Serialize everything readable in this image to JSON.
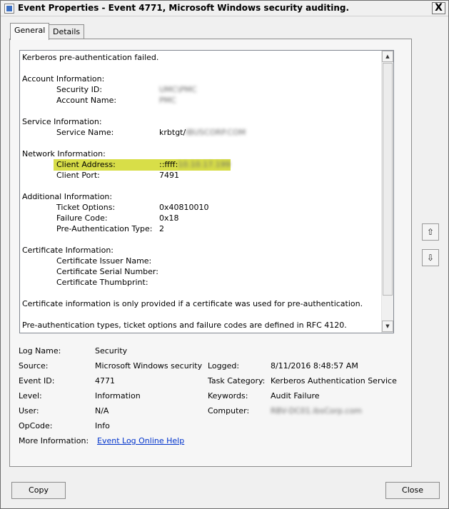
{
  "window": {
    "title": "Event Properties - Event 4771, Microsoft Windows security auditing.",
    "close_glyph": "X"
  },
  "tabs": [
    {
      "label": "General"
    },
    {
      "label": "Details"
    }
  ],
  "description": {
    "summary": "Kerberos pre-authentication failed.",
    "account_info": {
      "header": "Account Information:",
      "security_id_label": "Security ID:",
      "security_id_value": "UMC\\PMC",
      "account_name_label": "Account Name:",
      "account_name_value": "PMC"
    },
    "service_info": {
      "header": "Service Information:",
      "service_name_label": "Service Name:",
      "service_name_prefix": "krbtgt/",
      "service_name_blurred": "IBUSCORP.COM"
    },
    "network_info": {
      "header": "Network Information:",
      "client_address_label": "Client Address:",
      "client_address_prefix": "::ffff:",
      "client_address_blurred": "10.10.17.199",
      "client_port_label": "Client Port:",
      "client_port_value": "7491"
    },
    "additional_info": {
      "header": "Additional Information:",
      "ticket_options_label": "Ticket Options:",
      "ticket_options_value": "0x40810010",
      "failure_code_label": "Failure Code:",
      "failure_code_value": "0x18",
      "preauth_type_label": "Pre-Authentication Type:",
      "preauth_type_value": "2"
    },
    "certificate_info": {
      "header": "Certificate Information:",
      "issuer_label": "Certificate Issuer Name:",
      "serial_label": "Certificate Serial Number:",
      "thumbprint_label": "Certificate Thumbprint:"
    },
    "note1": "Certificate information is only provided if a certificate was used for pre-authentication.",
    "note2": "Pre-authentication types, ticket options and failure codes are defined in RFC 4120."
  },
  "fields": {
    "log_name_label": "Log Name:",
    "log_name_value": "Security",
    "source_label": "Source:",
    "source_value": "Microsoft Windows security",
    "logged_label": "Logged:",
    "logged_value": "8/11/2016 8:48:57 AM",
    "event_id_label": "Event ID:",
    "event_id_value": "4771",
    "task_category_label": "Task Category:",
    "task_category_value": "Kerberos Authentication Service",
    "level_label": "Level:",
    "level_value": "Information",
    "keywords_label": "Keywords:",
    "keywords_value": "Audit Failure",
    "user_label": "User:",
    "user_value": "N/A",
    "computer_label": "Computer:",
    "computer_value": "RBV-DC01.ibsCorp.com",
    "opcode_label": "OpCode:",
    "opcode_value": "Info",
    "more_info_label": "More Information:",
    "more_info_link": "Event Log Online Help"
  },
  "buttons": {
    "copy_label": "Copy",
    "close_label": "Close"
  },
  "icons": {
    "scroll_up": "▲",
    "scroll_down": "▼",
    "nav_up": "⇧",
    "nav_down": "⇩"
  },
  "colors": {
    "highlight": "#d8de48",
    "link": "#0033cc"
  }
}
